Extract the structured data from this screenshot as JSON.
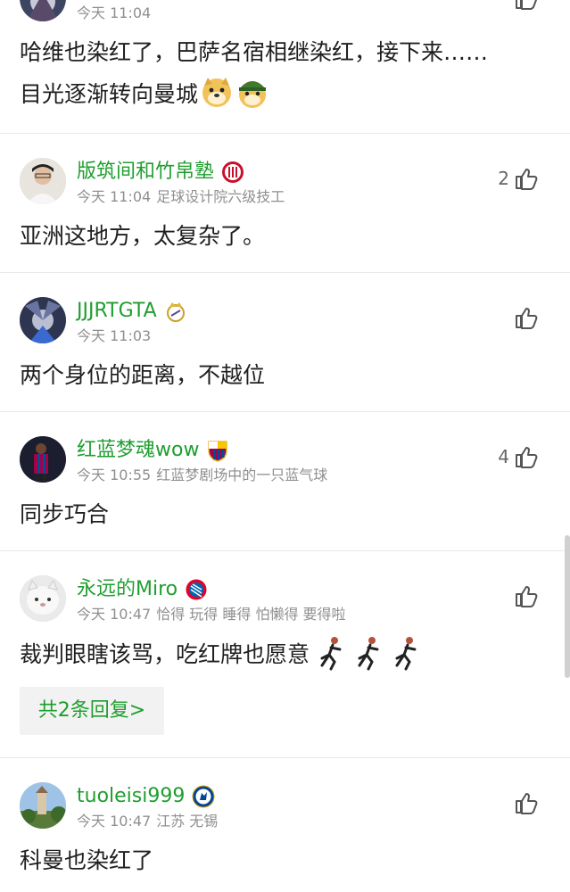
{
  "comments": [
    {
      "id": "c0",
      "time": "今天 11:04",
      "line1": "哈维也染红了，巴萨名宿相继染红，接下来……",
      "line2": "目光逐渐转向曼城",
      "emojis": [
        "doge-emoji",
        "doge-helmet-emoji"
      ]
    },
    {
      "id": "c1",
      "username": "版筑间和竹帛塾",
      "badge": "club-badge-red-icon",
      "time": "今天 11:04",
      "extra": "足球设计院六级技工",
      "like_count": "2",
      "text": "亚洲这地方，太复杂了。"
    },
    {
      "id": "c2",
      "username": "JJJRTGTA",
      "badge": "real-madrid-badge-icon",
      "time": "今天 11:03",
      "extra": "",
      "like_count": "",
      "text": "两个身位的距离，不越位"
    },
    {
      "id": "c3",
      "username": "红蓝梦魂wow",
      "badge": "barcelona-badge-icon",
      "time": "今天 10:55",
      "extra": "红蓝梦剧场中的一只蓝气球",
      "like_count": "4",
      "text": "同步巧合"
    },
    {
      "id": "c4",
      "username": "永远的Miro",
      "badge": "bayern-badge-icon",
      "time": "今天 10:47",
      "extra": "恰得 玩得 睡得 怕懒得 要得啦",
      "like_count": "",
      "text": "裁判眼瞎该骂，吃红牌也愿意",
      "reply_label": "共2条回复>"
    },
    {
      "id": "c5",
      "username": "tuoleisi999",
      "badge": "chelsea-badge-icon",
      "time": "今天 10:47",
      "extra": "江苏 无锡",
      "like_count": "",
      "text": "科曼也染红了"
    }
  ],
  "colors": {
    "username": "#1f9e2f",
    "meta": "#8f8f8f",
    "text": "#1f1f1f",
    "reply_bg": "#f2f2f2",
    "divider": "#e9e9e9"
  }
}
